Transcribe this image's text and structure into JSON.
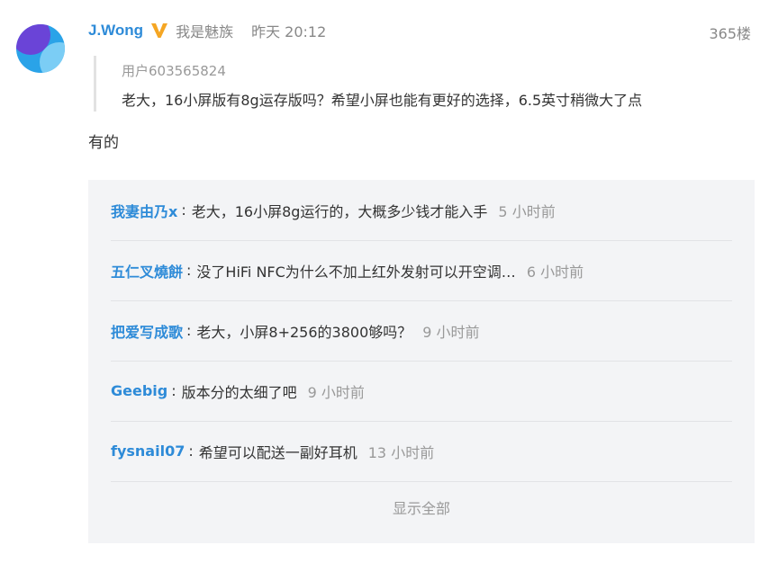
{
  "post": {
    "author": "J.Wong",
    "group": "我是魅族",
    "time": "昨天 20:12",
    "floor": "365楼",
    "quote": {
      "user": "用户603565824",
      "text": "老大，16小屏版有8g运存版吗？希望小屏也能有更好的选择，6.5英寸稍微大了点"
    },
    "reply": "有的"
  },
  "sub_replies": [
    {
      "name": "我妻由乃x",
      "sep": ":",
      "text": "老大，16小屏8g运行的，大概多少钱才能入手",
      "time": "5 小时前"
    },
    {
      "name": "五仁叉燒餅",
      "sep": ":",
      "text": "没了HiFi NFC为什么不加上红外发射可以开空调…",
      "time": "6 小时前"
    },
    {
      "name": "把爱写成歌",
      "sep": ":",
      "text": "老大，小屏8+256的3800够吗？",
      "time": "9 小时前"
    },
    {
      "name": "Geebig",
      "sep": ":",
      "text": "版本分的太细了吧",
      "time": "9 小时前"
    },
    {
      "name": "fysnail07",
      "sep": ":",
      "text": "希望可以配送一副好耳机",
      "time": "13 小时前"
    }
  ],
  "show_all_label": "显示全部",
  "colors": {
    "link": "#2e8bd8",
    "muted": "#999999",
    "panel": "#f3f4f6",
    "verified": "#f5a623"
  },
  "icons": {
    "verified": "verified-v-icon"
  }
}
